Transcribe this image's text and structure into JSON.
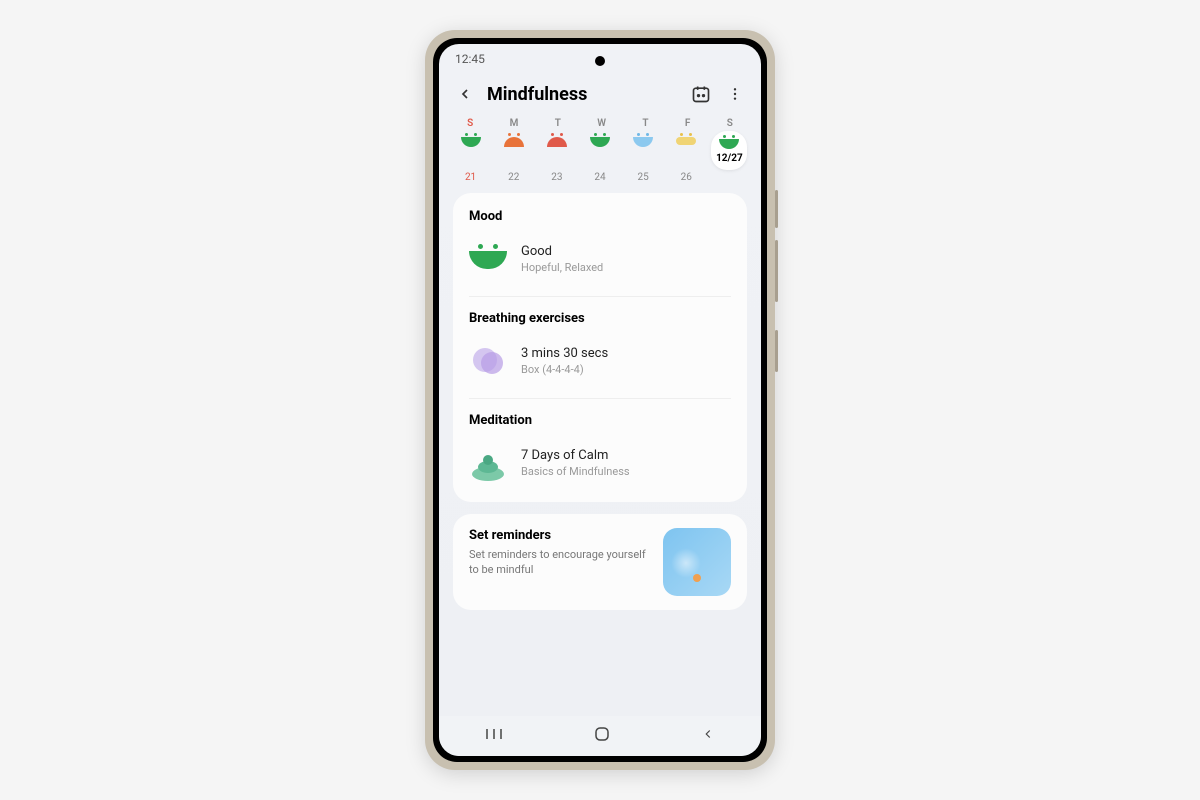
{
  "status": {
    "time": "12:45"
  },
  "header": {
    "title": "Mindfulness"
  },
  "week": {
    "days": [
      "S",
      "M",
      "T",
      "W",
      "T",
      "F",
      "S"
    ],
    "moods": [
      "green-happy",
      "orange-sad",
      "red-sad",
      "green-happy",
      "blue-happy",
      "yellow-neutral",
      "green-happy"
    ],
    "dates": [
      "21",
      "22",
      "23",
      "24",
      "25",
      "26",
      "12/27"
    ],
    "today_index": 6
  },
  "mood": {
    "title": "Mood",
    "value": "Good",
    "tags": "Hopeful, Relaxed"
  },
  "breathing": {
    "title": "Breathing exercises",
    "value": "3 mins 30 secs",
    "sub": "Box (4-4-4-4)"
  },
  "meditation": {
    "title": "Meditation",
    "value": "7 Days of Calm",
    "sub": "Basics of Mindfulness"
  },
  "reminders": {
    "title": "Set reminders",
    "sub": "Set reminders to encourage yourself to be mindful"
  }
}
